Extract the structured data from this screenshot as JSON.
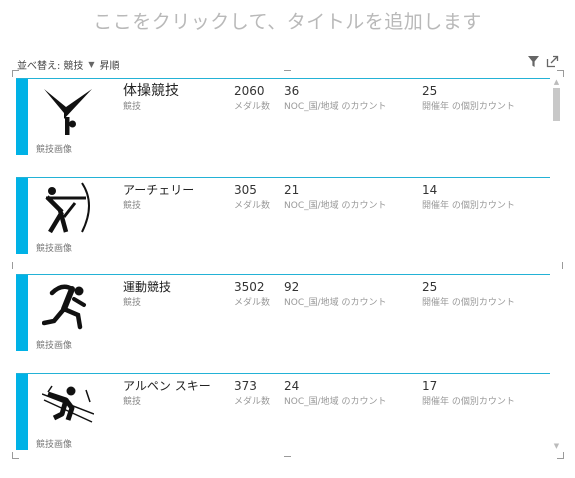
{
  "title": {
    "placeholder": "ここをクリックして、タイトルを追加します"
  },
  "sort": {
    "label": "並べ替え:",
    "field": "競技",
    "order": "昇順"
  },
  "toolbar": {
    "icons": [
      "filter-icon",
      "expand-icon"
    ]
  },
  "cards": [
    {
      "name": "体操競技",
      "sub": "競技",
      "medals": "2060",
      "medals_label": "メダル数",
      "noc": "36",
      "noc_label": "NOC_国/地域 のカウント",
      "years": "25",
      "years_label": "開催年 の個別カウント",
      "image_caption": "競技画像",
      "icon": "gymnastics-pictogram-icon"
    },
    {
      "name": "アーチェリー",
      "sub": "競技",
      "medals": "305",
      "medals_label": "メダル数",
      "noc": "21",
      "noc_label": "NOC_国/地域 のカウント",
      "years": "14",
      "years_label": "開催年 の個別カウント",
      "image_caption": "競技画像",
      "icon": "archery-pictogram-icon"
    },
    {
      "name": "運動競技",
      "sub": "競技",
      "medals": "3502",
      "medals_label": "メダル数",
      "noc": "92",
      "noc_label": "NOC_国/地域 のカウント",
      "years": "25",
      "years_label": "開催年 の個別カウント",
      "image_caption": "競技画像",
      "icon": "athletics-pictogram-icon"
    },
    {
      "name": "アルペン スキー",
      "sub": "競技",
      "medals": "373",
      "medals_label": "メダル数",
      "noc": "24",
      "noc_label": "NOC_国/地域 のカウント",
      "years": "17",
      "years_label": "開催年 の個別カウント",
      "image_caption": "競技画像",
      "icon": "alpine-skiing-pictogram-icon"
    }
  ],
  "colors": {
    "accent": "#00b2e6",
    "divider": "#23b2d6",
    "title_placeholder": "#b9b9b9"
  }
}
